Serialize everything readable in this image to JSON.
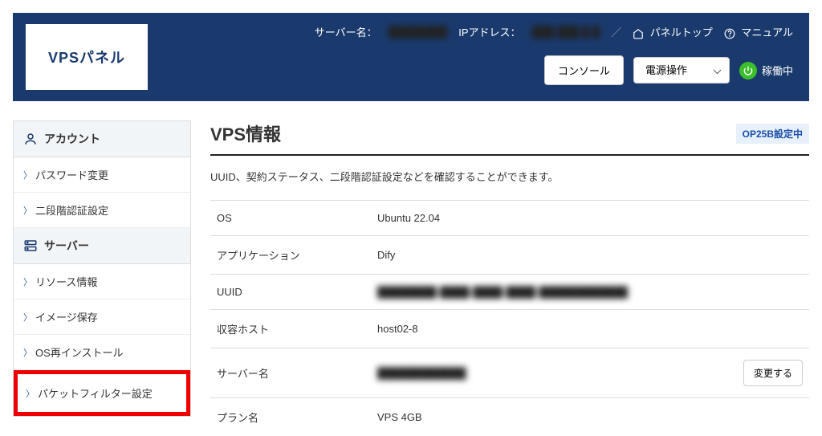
{
  "header": {
    "logo": "VPSパネル",
    "server_name_label": "サーバー名：",
    "server_name_value": "████████",
    "ip_label": "IPアドレス：",
    "ip_value": "███.███.█.█",
    "panel_top": "パネルトップ",
    "manual": "マニュアル",
    "console_btn": "コンソール",
    "power_select": "電源操作",
    "status": "稼働中"
  },
  "sidebar": {
    "account": {
      "title": "アカウント",
      "items": [
        "パスワード変更",
        "二段階認証設定"
      ]
    },
    "server": {
      "title": "サーバー",
      "items": [
        "リソース情報",
        "イメージ保存",
        "OS再インストール",
        "パケットフィルター設定"
      ]
    }
  },
  "content": {
    "title": "VPS情報",
    "badge": "OP25B設定中",
    "description": "UUID、契約ステータス、二段階認証設定などを確認することができます。",
    "rows": {
      "os": {
        "label": "OS",
        "value": "Ubuntu 22.04"
      },
      "app": {
        "label": "アプリケーション",
        "value": "Dify"
      },
      "uuid": {
        "label": "UUID",
        "value": "████████-████-████-████-████████████"
      },
      "host": {
        "label": "収容ホスト",
        "value": "host02-8"
      },
      "server_name": {
        "label": "サーバー名",
        "value": "████████████",
        "action": "変更する"
      },
      "plan": {
        "label": "プラン名",
        "value": "VPS 4GB"
      }
    }
  }
}
